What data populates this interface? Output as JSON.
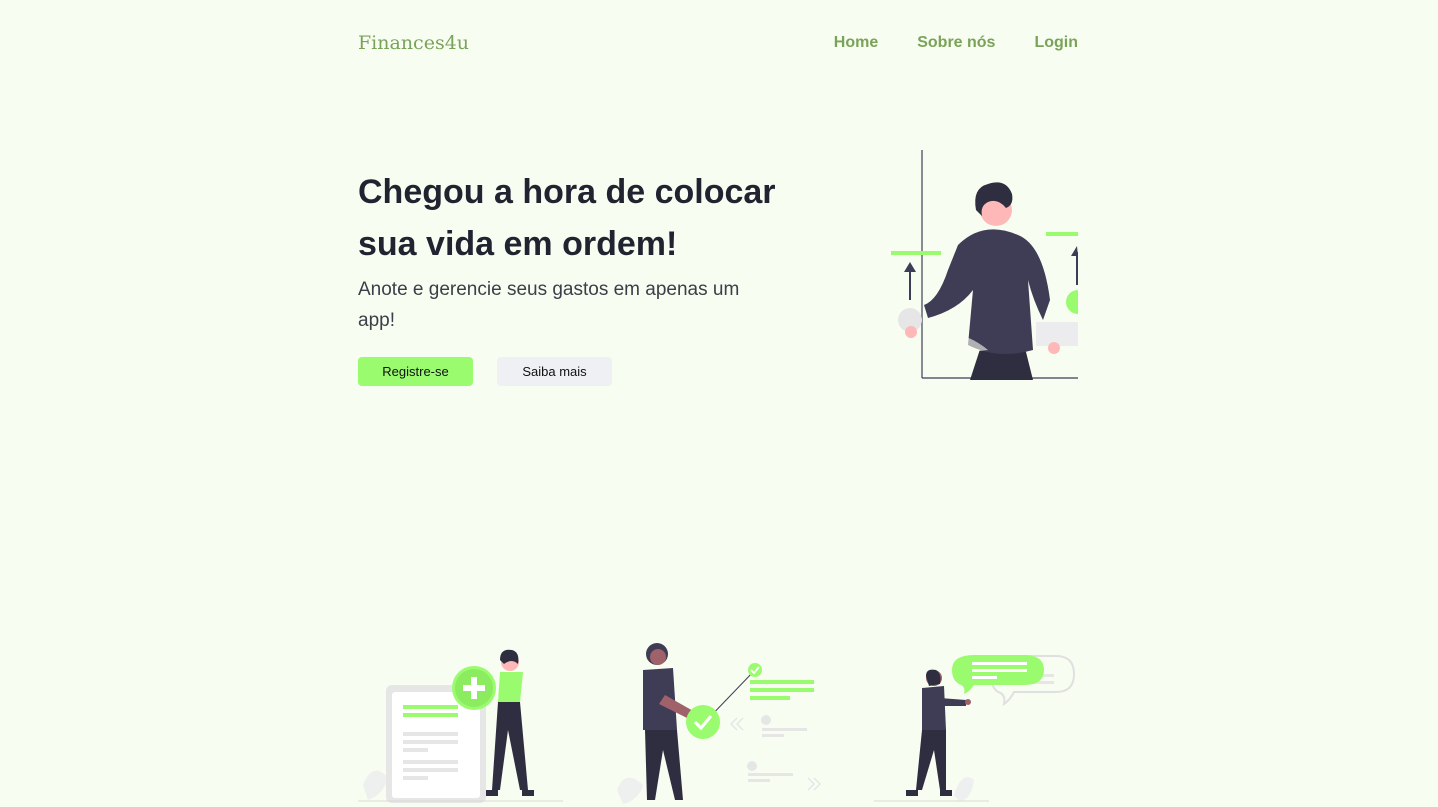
{
  "brand": {
    "name": "Finances4u"
  },
  "nav": {
    "items": [
      {
        "label": "Home"
      },
      {
        "label": "Sobre nós"
      },
      {
        "label": "Login"
      }
    ]
  },
  "hero": {
    "title": "Chegou a hora de colocar sua vida em ordem!",
    "subtitle": "Anote e gerencie seus gastos em apenas um app!",
    "primary_button": "Registre-se",
    "secondary_button": "Saiba mais"
  },
  "colors": {
    "accent": "#9afb6e",
    "brand": "#7aa35a",
    "background": "#f8fdf1",
    "dark": "#3f3d56"
  },
  "icons": [
    "hero-person-illustration",
    "add-document-illustration",
    "checkmark-illustration",
    "chat-illustration"
  ]
}
